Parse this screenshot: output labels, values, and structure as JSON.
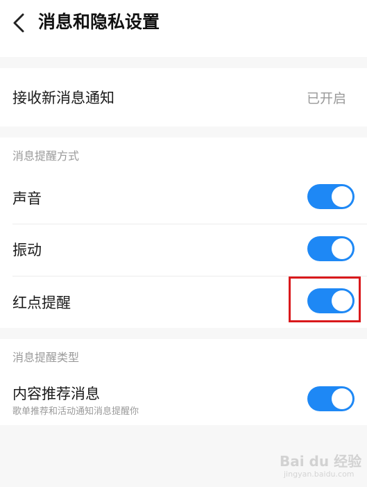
{
  "header": {
    "title": "消息和隐私设置",
    "back_icon": "chevron-left-icon"
  },
  "receive_notifications": {
    "label": "接收新消息通知",
    "value": "已开启"
  },
  "reminder_method": {
    "section_title": "消息提醒方式",
    "items": [
      {
        "label": "声音",
        "enabled": true
      },
      {
        "label": "振动",
        "enabled": true
      },
      {
        "label": "红点提醒",
        "enabled": true
      }
    ]
  },
  "reminder_type": {
    "section_title": "消息提醒类型",
    "items": [
      {
        "label": "内容推荐消息",
        "sublabel": "歌单推荐和活动通知消息提醒你",
        "enabled": true
      }
    ]
  },
  "colors": {
    "toggle_on": "#1e88f5",
    "highlight": "#d9191c"
  },
  "watermark": {
    "main": "Bai du 经验",
    "sub": "jingyan.baidu.com"
  }
}
